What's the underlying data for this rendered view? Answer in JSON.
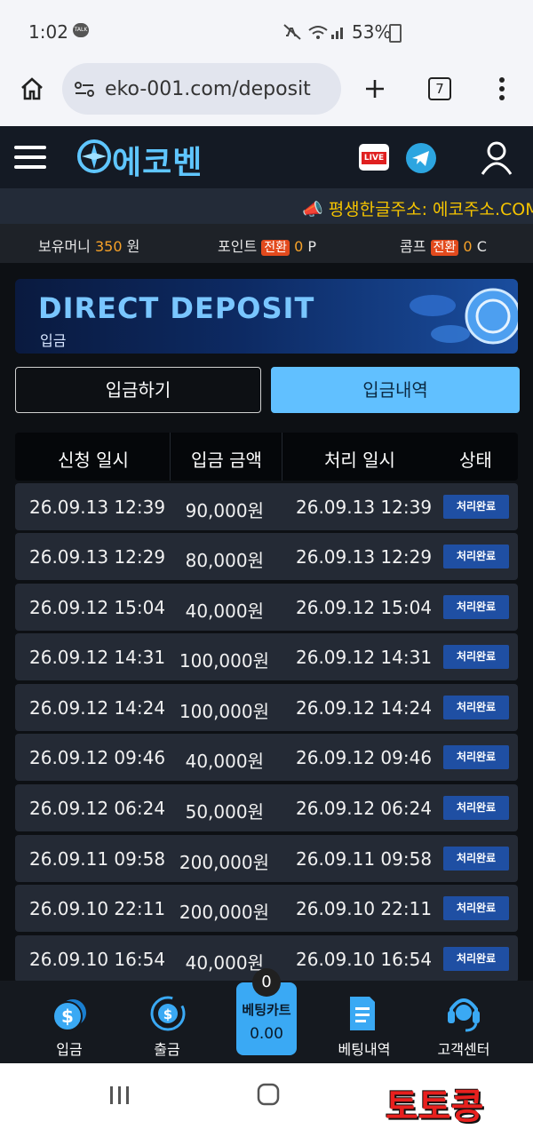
{
  "status": {
    "time": "1:02",
    "talk_label": "TALK",
    "battery": "53%"
  },
  "browser": {
    "url": "eko-001.com/deposit",
    "tab_count": "7"
  },
  "site": {
    "logo": "에코벤",
    "live_label": "LIVE"
  },
  "ticker": "📣 평생한글주소: 에코주소.COM 📣",
  "balance": {
    "money_label": "보유머니",
    "money_value": "350",
    "money_unit": "원",
    "point_label": "포인트",
    "point_badge": "전환",
    "point_value": "0",
    "point_unit": "P",
    "comp_label": "콤프",
    "comp_badge": "전환",
    "comp_value": "0",
    "comp_unit": "C"
  },
  "banner": {
    "title": "DIRECT DEPOSIT",
    "subtitle": "입금"
  },
  "tabs": {
    "deposit": "입금하기",
    "history": "입금내역"
  },
  "table": {
    "headers": [
      "신청 일시",
      "입금 금액",
      "처리 일시",
      "상태"
    ],
    "rows": [
      {
        "requested": "26.09.13 12:39",
        "amount": "90,000원",
        "processed": "26.09.13 12:39",
        "status": "처리완료"
      },
      {
        "requested": "26.09.13 12:29",
        "amount": "80,000원",
        "processed": "26.09.13 12:29",
        "status": "처리완료"
      },
      {
        "requested": "26.09.12 15:04",
        "amount": "40,000원",
        "processed": "26.09.12 15:04",
        "status": "처리완료"
      },
      {
        "requested": "26.09.12 14:31",
        "amount": "100,000원",
        "processed": "26.09.12 14:31",
        "status": "처리완료"
      },
      {
        "requested": "26.09.12 14:24",
        "amount": "100,000원",
        "processed": "26.09.12 14:24",
        "status": "처리완료"
      },
      {
        "requested": "26.09.12 09:46",
        "amount": "40,000원",
        "processed": "26.09.12 09:46",
        "status": "처리완료"
      },
      {
        "requested": "26.09.12 06:24",
        "amount": "50,000원",
        "processed": "26.09.12 06:24",
        "status": "처리완료"
      },
      {
        "requested": "26.09.11 09:58",
        "amount": "200,000원",
        "processed": "26.09.11 09:58",
        "status": "처리완료"
      },
      {
        "requested": "26.09.10 22:11",
        "amount": "200,000원",
        "processed": "26.09.10 22:11",
        "status": "처리완료"
      },
      {
        "requested": "26.09.10 16:54",
        "amount": "40,000원",
        "processed": "26.09.10 16:54",
        "status": "처리완료"
      }
    ]
  },
  "bottom_nav": {
    "deposit": "입금",
    "withdraw": "출금",
    "cart_label": "베팅카트",
    "cart_value": "0.00",
    "cart_count": "0",
    "bet_history": "베팅내역",
    "support": "고객센터"
  },
  "watermark": "토토콩"
}
